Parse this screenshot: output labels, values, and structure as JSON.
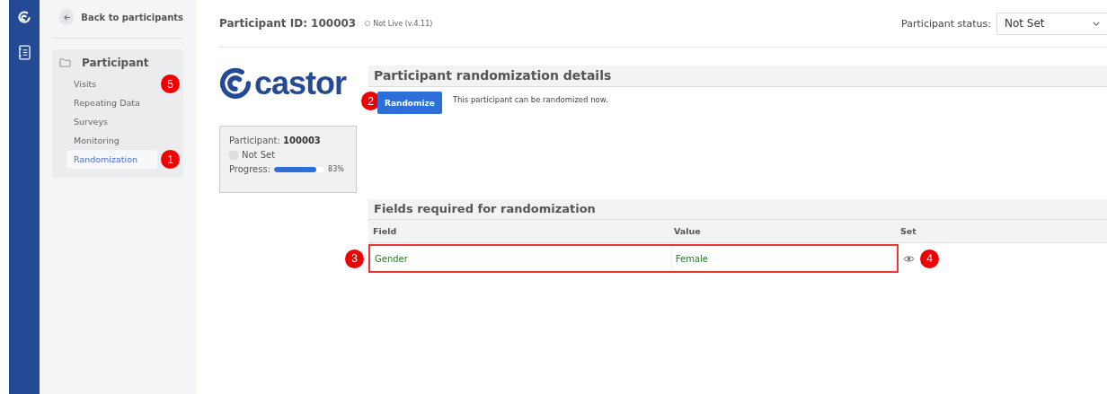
{
  "sidebar": {
    "back_label": "Back to participants",
    "section_title": "Participant",
    "items": [
      {
        "label": "Visits",
        "selected": false,
        "callout": "5"
      },
      {
        "label": "Repeating Data",
        "selected": false
      },
      {
        "label": "Surveys",
        "selected": false
      },
      {
        "label": "Monitoring",
        "selected": false
      },
      {
        "label": "Randomization",
        "selected": true,
        "callout": "1"
      }
    ]
  },
  "header": {
    "title": "Participant ID: 100003",
    "live_status": "Not Live (v.4.11)",
    "status_label": "Participant status:",
    "status_value": "Not Set"
  },
  "logo": {
    "text": "castor"
  },
  "summary": {
    "participant_label": "Participant:",
    "participant_id": "100003",
    "status": "Not Set",
    "status_checked": false,
    "progress_label": "Progress:",
    "level": 0.83,
    "reading": "83%"
  },
  "randomization": {
    "title": "Participant randomization details",
    "button": "Randomize",
    "button_callout": "2",
    "message": "This participant can be randomized now."
  },
  "fields": {
    "title": "Fields required for randomization",
    "columns": [
      "Field",
      "Value",
      "Set"
    ],
    "rows": [
      {
        "field": "Gender",
        "value": "Female",
        "highlighted": true,
        "row_callout": "3",
        "set_callout": "4"
      }
    ]
  }
}
